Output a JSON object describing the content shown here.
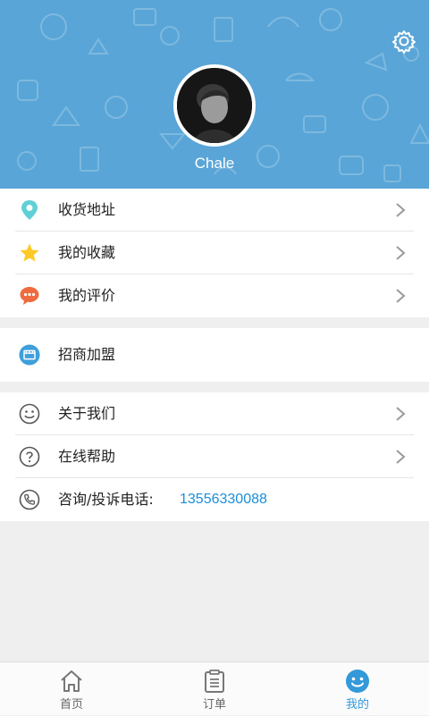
{
  "profile": {
    "username": "Chale",
    "settings_icon": "gear-icon"
  },
  "menu_group_1": [
    {
      "label": "收货地址",
      "icon": "location-pin-icon",
      "color": "#5fd0d6"
    },
    {
      "label": "我的收藏",
      "icon": "star-icon",
      "color": "#ffc926"
    },
    {
      "label": "我的评价",
      "icon": "comment-bubble-icon",
      "color": "#f06a3f"
    }
  ],
  "menu_group_2": [
    {
      "label": "招商加盟",
      "icon": "shop-icon",
      "color": "#3f9fdb"
    }
  ],
  "menu_group_3": [
    {
      "label": "关于我们",
      "icon": "smiley-icon"
    },
    {
      "label": "在线帮助",
      "icon": "question-circle-icon"
    },
    {
      "label": "咨询/投诉电话:",
      "value": "13556330088",
      "icon": "phone-icon"
    }
  ],
  "tabbar": {
    "tabs": [
      {
        "label": "首页",
        "icon": "home-icon"
      },
      {
        "label": "订单",
        "icon": "order-list-icon"
      },
      {
        "label": "我的",
        "icon": "profile-face-icon",
        "active": true
      }
    ]
  },
  "colors": {
    "header_bg": "#59a5d7",
    "accent": "#3499d9",
    "phone_link": "#1a8fd8",
    "page_bg": "#efefef"
  }
}
